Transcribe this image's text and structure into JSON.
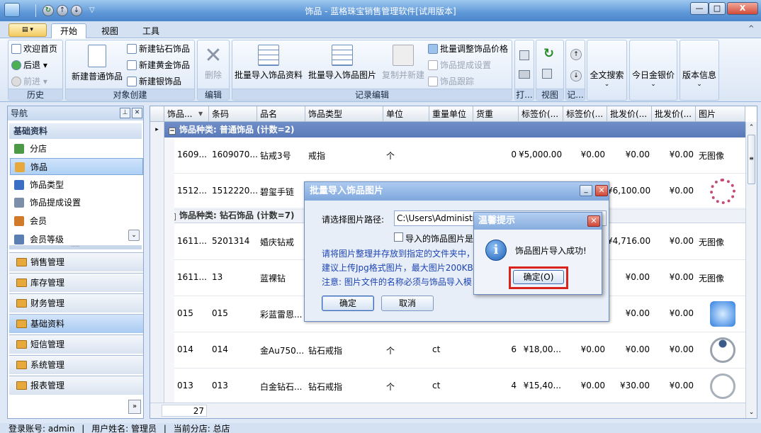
{
  "window": {
    "title": "饰品 - 蓝格珠宝销售管理软件[试用版本]",
    "min_label": "—",
    "max_label": "□",
    "close_label": "X"
  },
  "tabs": [
    {
      "label": "开始"
    },
    {
      "label": "视图"
    },
    {
      "label": "工具"
    }
  ],
  "ribbon": {
    "history": {
      "label": "历史",
      "items": [
        "欢迎首页",
        "后退",
        "前进"
      ]
    },
    "create": {
      "label": "对象创建",
      "big": "新建普通饰品",
      "items": [
        "新建钻石饰品",
        "新建黄金饰品",
        "新建银饰品"
      ]
    },
    "edit": {
      "label": "编辑",
      "delete": "删除"
    },
    "records": {
      "label": "记录编辑",
      "import_data": "批量导入饰品资料",
      "import_image": "批量导入饰品图片",
      "copy_new": "复制并新建",
      "items": [
        "批量调整饰品价格",
        "饰品提成设置",
        "饰品跟踪"
      ]
    },
    "print": {
      "label": "打..."
    },
    "view": {
      "label": "视图"
    },
    "record": {
      "label": "记..."
    },
    "fulltext": "全文搜索",
    "gold_price": "今日金银价",
    "version": "版本信息"
  },
  "nav": {
    "title": "导航",
    "section": "基础资料",
    "items": [
      {
        "label": "分店",
        "color": "#4c9a45"
      },
      {
        "label": "饰品",
        "color": "#e7a93b"
      },
      {
        "label": "饰品类型",
        "color": "#3a6fc4"
      },
      {
        "label": "饰品提成设置",
        "color": "#7b8fa8"
      },
      {
        "label": "会员",
        "color": "#d17a2a"
      },
      {
        "label": "会员等级",
        "color": "#5b7fb3"
      }
    ],
    "categories": [
      "销售管理",
      "库存管理",
      "财务管理",
      "基础资料",
      "短信管理",
      "系统管理",
      "报表管理"
    ]
  },
  "grid": {
    "columns": [
      "饰品...",
      "条码",
      "品名",
      "饰品类型",
      "单位",
      "重量单位",
      "货重",
      "标签价(...",
      "标签价(...",
      "批发价(...",
      "批发价(...",
      "图片"
    ],
    "group1": "饰品种类: 普通饰品 (计数=2)",
    "group2": "饰品种类: 钻石饰品 (计数=7)",
    "rows": [
      {
        "code": "1609...",
        "barcode": "1609070...",
        "name": "钻戒3号",
        "type": "戒指",
        "unit": "个",
        "wunit": "",
        "weight": "0",
        "tag1": "¥5,000.00",
        "tag2": "¥0.00",
        "ws1": "¥0.00",
        "ws2": "¥0.00",
        "img": "无图像"
      },
      {
        "code": "1512...",
        "barcode": "1512220...",
        "name": "碧玺手链",
        "type": "",
        "unit": "",
        "wunit": "",
        "weight": "",
        "tag1": "",
        "tag2": "",
        "ws1": "¥6,100.00",
        "ws2": "¥0.00",
        "img": ""
      },
      {
        "code": "1611...",
        "barcode": "5201314",
        "name": "婚庆钻戒",
        "type": "",
        "unit": "",
        "wunit": "",
        "weight": "",
        "tag1": "",
        "tag2": "",
        "ws1": "¥4,716.00",
        "ws2": "¥0.00",
        "img": "无图像"
      },
      {
        "code": "1611...",
        "barcode": "13",
        "name": "蓝裸钻",
        "type": "",
        "unit": "",
        "wunit": "",
        "weight": "",
        "tag1": "",
        "tag2": "",
        "ws1": "¥0.00",
        "ws2": "¥0.00",
        "img": "无图像"
      },
      {
        "code": "015",
        "barcode": "015",
        "name": "彩蓝雷恩...",
        "type": "",
        "unit": "",
        "wunit": "",
        "weight": "",
        "tag1": "",
        "tag2": "",
        "ws1": "¥0.00",
        "ws2": "¥0.00",
        "img": ""
      },
      {
        "code": "014",
        "barcode": "014",
        "name": "金Au750...",
        "type": "钻石戒指",
        "unit": "个",
        "wunit": "ct",
        "weight": "6",
        "tag1": "¥18,00...",
        "tag2": "¥0.00",
        "ws1": "¥0.00",
        "ws2": "¥0.00",
        "img": ""
      },
      {
        "code": "013",
        "barcode": "013",
        "name": "白金钻石...",
        "type": "钻石戒指",
        "unit": "个",
        "wunit": "ct",
        "weight": "4",
        "tag1": "¥15,40...",
        "tag2": "¥0.00",
        "ws1": "¥30.00",
        "ws2": "¥0.00",
        "img": ""
      }
    ],
    "footer_count": "27"
  },
  "import_dialog": {
    "title": "批量导入饰品图片",
    "path_label": "请选择图片路径:",
    "path_value": "C:\\Users\\Administrat",
    "checkbox_label": "导入的饰品图片是",
    "hint1": "请将图片整理并存放到指定的文件夹中，",
    "hint2": "建议上传Jpg格式图片，最大图片200KB",
    "hint3": "注意: 图片文件的名称必须与饰品导入模",
    "ok": "确定",
    "cancel": "取消"
  },
  "alert": {
    "title": "温馨提示",
    "message": "饰品图片导入成功!",
    "ok": "确定(O)",
    "icon": "info-icon"
  },
  "status": {
    "account": "登录账号: admin",
    "user": "用户姓名: 管理员",
    "branch": "当前分店: 总店"
  },
  "colors": {
    "accent": "#5a79b8",
    "highlight": "#d9231d"
  }
}
